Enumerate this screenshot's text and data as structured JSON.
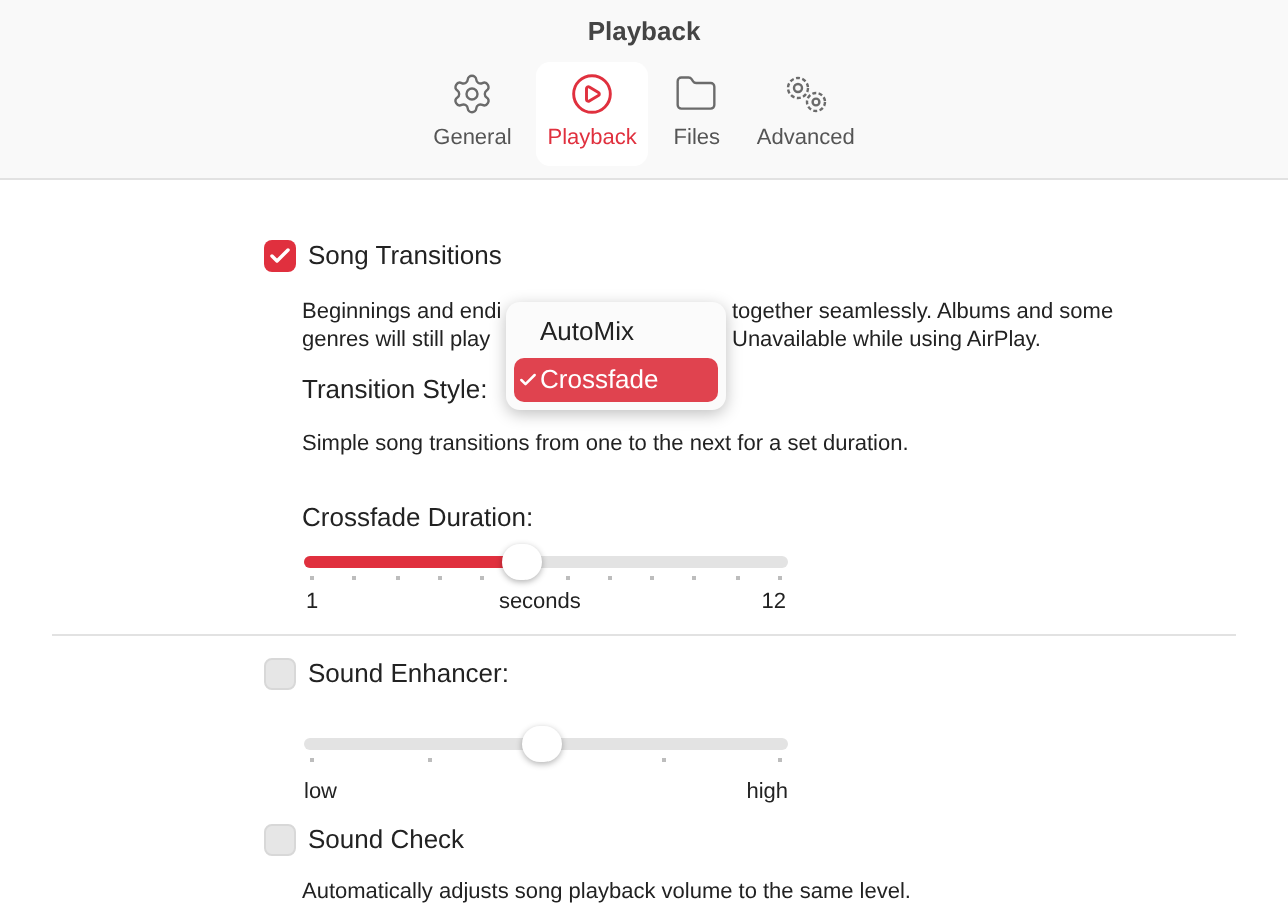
{
  "window": {
    "title": "Playback"
  },
  "tabs": [
    {
      "label": "General",
      "selected": false
    },
    {
      "label": "Playback",
      "selected": true
    },
    {
      "label": "Files",
      "selected": false
    },
    {
      "label": "Advanced",
      "selected": false
    }
  ],
  "song_transitions": {
    "label": "Song Transitions",
    "checked": true,
    "description_lines": [
      [
        "Beginnings and endi",
        "together seamlessly. Albums and some"
      ],
      [
        "genres will still play",
        "Unavailable while using AirPlay."
      ]
    ],
    "style_label": "Transition Style:",
    "style_menu": [
      {
        "label": "AutoMix",
        "selected": false
      },
      {
        "label": "Crossfade",
        "selected": true
      }
    ],
    "style_note": "Simple song transitions from one to the next for a set duration.",
    "duration_label": "Crossfade Duration:",
    "duration": {
      "level": 0.45,
      "min_label": "1",
      "mid_label": "seconds",
      "max_label": "12"
    }
  },
  "sound_enhancer": {
    "label": "Sound Enhancer:",
    "checked": false,
    "level": 0.49,
    "min_label": "low",
    "max_label": "high"
  },
  "sound_check": {
    "label": "Sound Check",
    "checked": false,
    "description": "Automatically adjusts song playback volume to the same level."
  }
}
